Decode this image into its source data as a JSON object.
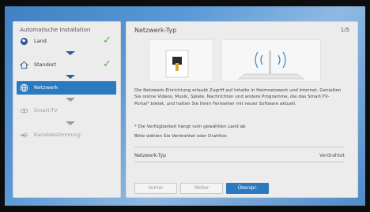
{
  "left": {
    "title": "Automatische Installation",
    "steps": [
      {
        "label": "Land",
        "icon": "globe-icon",
        "done": true
      },
      {
        "label": "Standort",
        "icon": "home-icon",
        "done": true
      },
      {
        "label": "Netzwerk",
        "icon": "network-globe-icon",
        "active": true
      },
      {
        "label": "Smart-TV",
        "icon": "smart-tv-icon",
        "disabled": true
      },
      {
        "label": "Kanalabstimmung",
        "icon": "antenna-icon",
        "disabled": true
      }
    ]
  },
  "right": {
    "title": "Netzwerk-Typ",
    "page": "1/5",
    "description": "Die Netzwerk-Einrichtung erlaubt Zugriff auf Inhalte in Heimnetzwerk und Internet. Genießen Sie online Videos, Musik, Spiele, Nachrichten und andere Programme, die das Smart-TV-Portal* bietet, und halten Sie Ihren Fernseher mit neuer Software aktuell.",
    "note": "* Die Verfügbarkeit hängt vom gewählten Land ab",
    "prompt": "Bitte wählen Sie Verdrahtet oder Drahtlos",
    "setting_label": "Netzwerk-Typ",
    "setting_value": "Verdrahtet",
    "buttons": {
      "prev": "Vorher",
      "next": "Weiter",
      "skip": "Überspr."
    }
  },
  "colors": {
    "accent": "#2b7ac0",
    "check": "#4cb33a"
  }
}
